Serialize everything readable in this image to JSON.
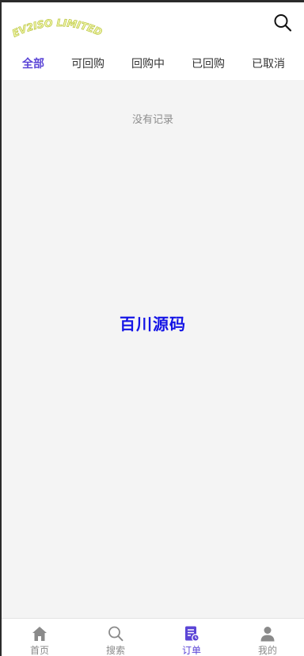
{
  "header": {
    "logo_text": "EV2ISO LIMITED",
    "search_icon": "search-icon"
  },
  "tabs": [
    {
      "label": "全部",
      "active": true
    },
    {
      "label": "可回购",
      "active": false
    },
    {
      "label": "回购中",
      "active": false
    },
    {
      "label": "已回购",
      "active": false
    },
    {
      "label": "已取消",
      "active": false
    }
  ],
  "main": {
    "empty_text": "没有记录",
    "watermark": "百川源码"
  },
  "bottom_nav": [
    {
      "label": "首页",
      "icon": "home-icon",
      "active": false
    },
    {
      "label": "搜索",
      "icon": "search-icon",
      "active": false
    },
    {
      "label": "订单",
      "icon": "order-icon",
      "active": true
    },
    {
      "label": "我的",
      "icon": "user-icon",
      "active": false
    }
  ],
  "colors": {
    "accent": "#5b45d6",
    "background": "#f4f4f4",
    "logo": "#d8e34a",
    "watermark": "#1414e6"
  }
}
